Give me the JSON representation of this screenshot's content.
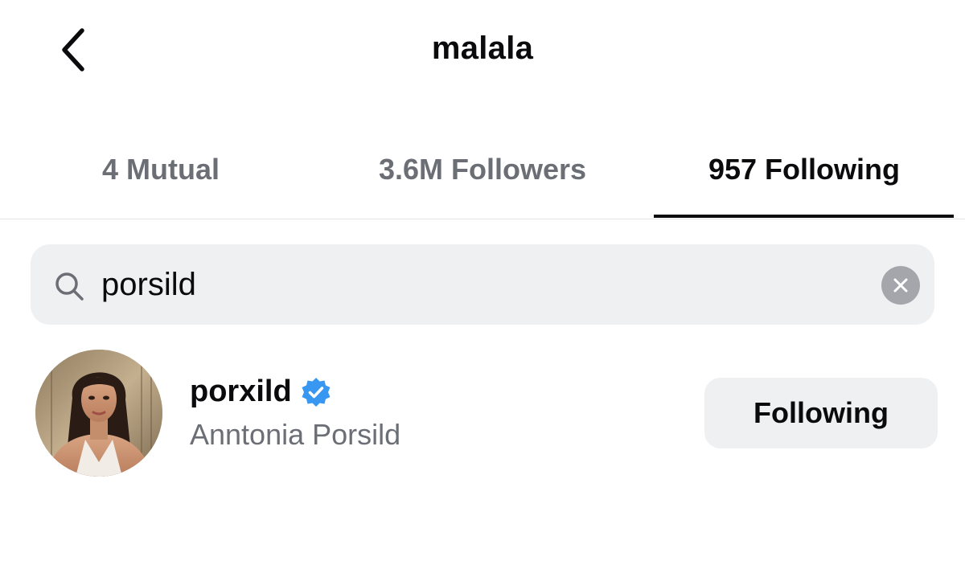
{
  "header": {
    "back_icon": "chevron-left-icon",
    "title": "malala"
  },
  "tabs": [
    {
      "label": "4 Mutual",
      "active": false
    },
    {
      "label": "3.6M Followers",
      "active": false
    },
    {
      "label": "957 Following",
      "active": true
    }
  ],
  "search": {
    "icon": "search-icon",
    "value": "porsild",
    "clear_icon": "clear-icon"
  },
  "results": [
    {
      "username": "porxild",
      "verified": true,
      "full_name": "Anntonia Porsild",
      "button_label": "Following"
    }
  ],
  "colors": {
    "text_primary": "#0b0b0d",
    "text_secondary": "#6b6f75",
    "surface": "#eff0f2",
    "verified_blue": "#3897f0",
    "divider": "#e3e3e6"
  }
}
